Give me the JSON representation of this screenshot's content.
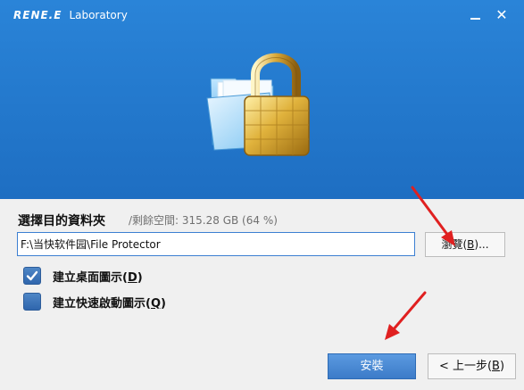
{
  "window": {
    "brand_bold": "RENE.E",
    "brand_rest": "Laboratory",
    "minimize_icon": "minimize-icon",
    "close_icon": "close-icon",
    "close_glyph": "✕"
  },
  "hero": {
    "icon": "folder-padlock-icon"
  },
  "destination": {
    "label": "選擇目的資料夾",
    "space_info": "/剩餘空間: 315.28 GB (64 %)",
    "path_value": "F:\\当快软件园\\File Protector",
    "browse_label_pre": "瀏覽(",
    "browse_hotkey": "B",
    "browse_label_post": ")..."
  },
  "options": [
    {
      "label_pre": "建立桌面圖示(",
      "hotkey": "D",
      "label_post": ")",
      "checked": true
    },
    {
      "label_pre": "建立快速啟動圖示(",
      "hotkey": "Q",
      "label_post": ")",
      "checked": false
    }
  ],
  "footer": {
    "install_label": "安裝",
    "back_label_pre": "< 上一步(",
    "back_hotkey": "B",
    "back_label_post": ")"
  },
  "colors": {
    "header_blue": "#2378cc",
    "accent_blue": "#3c7bc8",
    "annotation_red": "#e02020"
  }
}
